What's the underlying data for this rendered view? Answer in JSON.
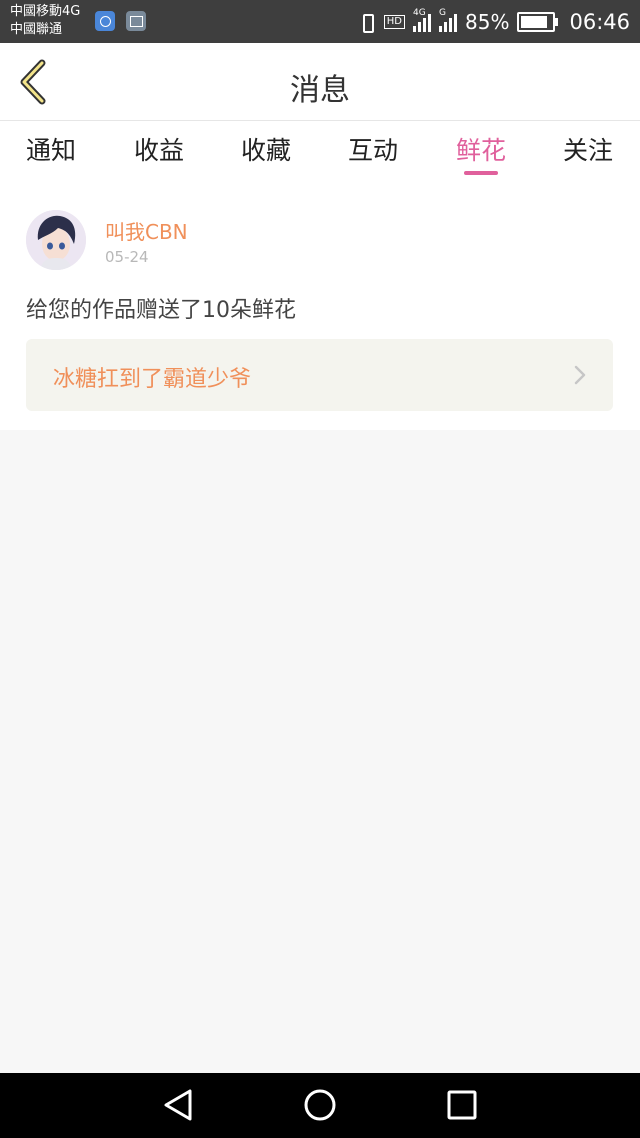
{
  "status_bar": {
    "carrier_1": "中國移動4G",
    "carrier_2": "中國聯通",
    "network_type_1": "4G",
    "network_type_2": "G",
    "hd_label": "HD",
    "battery_percent": "85%",
    "time": "06:46"
  },
  "header": {
    "title": "消息",
    "back_icon": "chevron-left-icon"
  },
  "tabs": {
    "items": [
      {
        "label": "通知",
        "active": false
      },
      {
        "label": "收益",
        "active": false
      },
      {
        "label": "收藏",
        "active": false
      },
      {
        "label": "互动",
        "active": false
      },
      {
        "label": "鲜花",
        "active": true
      },
      {
        "label": "关注",
        "active": false
      }
    ],
    "active_color": "#e0609c"
  },
  "notification": {
    "user_name": "叫我CBN",
    "date": "05-24",
    "message": "给您的作品赠送了10朵鲜花",
    "work_title": "冰糖扛到了霸道少爷",
    "accent_color": "#f0905a"
  },
  "nav_bar": {
    "back_icon": "triangle-back-icon",
    "home_icon": "circle-home-icon",
    "recents_icon": "square-recents-icon"
  }
}
